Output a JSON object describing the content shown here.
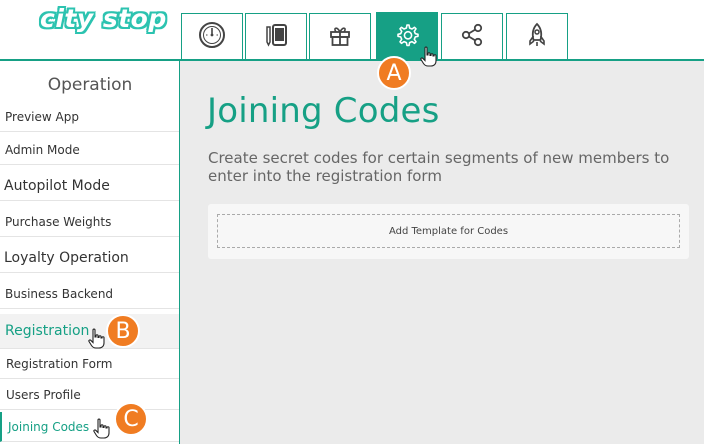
{
  "header": {
    "logo": "city stop",
    "tabs": [
      {
        "icon": "speedometer-icon",
        "active": false
      },
      {
        "icon": "mobile-edit-icon",
        "active": false
      },
      {
        "icon": "gift-icon",
        "active": false
      },
      {
        "icon": "gear-icon",
        "active": true
      },
      {
        "icon": "share-icon",
        "active": false
      },
      {
        "icon": "rocket-icon",
        "active": false
      }
    ]
  },
  "sidebar": {
    "title": "Operation",
    "items": [
      {
        "label": "Preview App"
      },
      {
        "label": "Admin Mode"
      },
      {
        "label": "Autopilot Mode"
      },
      {
        "label": "Purchase Weights"
      },
      {
        "label": "Loyalty Operation"
      },
      {
        "label": "Business Backend"
      },
      {
        "label": "Registration"
      },
      {
        "label": "Registration Form"
      },
      {
        "label": "Users Profile"
      },
      {
        "label": "Joining Codes"
      }
    ]
  },
  "main": {
    "title": "Joining Codes",
    "description": "Create secret codes for certain segments of new members to enter into the registration form",
    "add_template_label": "Add Template for Codes"
  },
  "markers": {
    "a": "A",
    "b": "B",
    "c": "C"
  },
  "colors": {
    "accent": "#16a085",
    "marker": "#f07c22",
    "main_bg": "#ebebeb"
  }
}
